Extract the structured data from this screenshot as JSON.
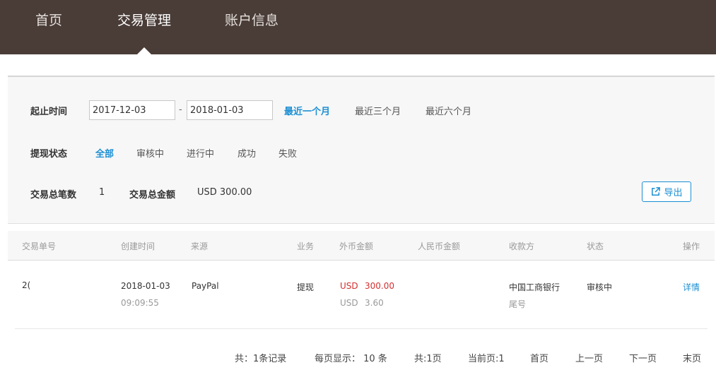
{
  "nav": {
    "items": [
      "首页",
      "交易管理",
      "账户信息"
    ]
  },
  "filter": {
    "date_label": "起止时间",
    "date_start": "2017-12-03",
    "date_sep": "-",
    "date_end": "2018-01-03",
    "ranges": [
      "最近一个月",
      "最近三个月",
      "最近六个月"
    ],
    "status_label": "提现状态",
    "statuses": [
      "全部",
      "审核中",
      "进行中",
      "成功",
      "失败"
    ],
    "count_label": "交易总笔数",
    "count_value": "1",
    "amount_label": "交易总金额",
    "amount_value": "USD 300.00",
    "export_label": "导出"
  },
  "table": {
    "headers": [
      "交易单号",
      "创建时间",
      "来源",
      "业务",
      "外币金额",
      "人民币金额",
      "收款方",
      "状态",
      "操作"
    ],
    "rows": [
      {
        "order_no": "2(  ",
        "date": "2018-01-03",
        "time": "09:09:55",
        "source": "PayPal",
        "business": "提现",
        "fx_currency": "USD",
        "fx_amount": "300.00",
        "fee_currency": "USD",
        "fee_amount": "3.60",
        "cny_amount": "",
        "payee": "中国工商银行",
        "payee_sub": "尾号",
        "status": "审核中",
        "action": "详情"
      }
    ]
  },
  "pager": {
    "total": "共：1条记录",
    "per_page": "每页显示：  10 条",
    "pages": "共:1页",
    "current": "当前页:1",
    "first": "首页",
    "prev": "上一页",
    "next": "下一页",
    "last": "末页"
  },
  "colors": {
    "nav_bg": "#4a3d38",
    "accent": "#1b8fd3",
    "amount_red": "#d32f2f"
  }
}
